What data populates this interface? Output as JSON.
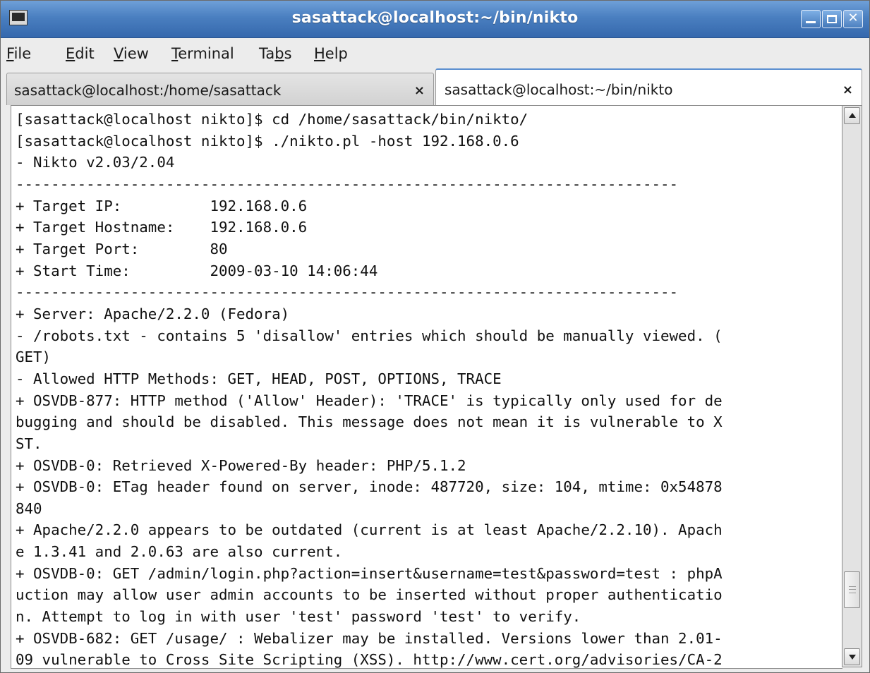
{
  "window": {
    "title": "sasattack@localhost:~/bin/nikto",
    "icon": "terminal-icon",
    "controls": {
      "minimize": "minimize",
      "maximize": "maximize",
      "close": "close"
    }
  },
  "menu": {
    "items": [
      {
        "label": "File",
        "mnemonic": "F",
        "rest": "ile"
      },
      {
        "label": "Edit",
        "mnemonic": "E",
        "rest": "dit"
      },
      {
        "label": "View",
        "mnemonic": "V",
        "rest": "iew"
      },
      {
        "label": "Terminal",
        "mnemonic": "T",
        "rest": "erminal"
      },
      {
        "label": "Tabs",
        "pre": "Ta",
        "mnemonic": "b",
        "rest": "s"
      },
      {
        "label": "Help",
        "mnemonic": "H",
        "rest": "elp"
      }
    ]
  },
  "tabs": [
    {
      "label": "sasattack@localhost:/home/sasattack",
      "close": "×",
      "active": false
    },
    {
      "label": "sasattack@localhost:~/bin/nikto",
      "close": "×",
      "active": true
    }
  ],
  "terminal": {
    "lines": [
      "[sasattack@localhost nikto]$ cd /home/sasattack/bin/nikto/",
      "[sasattack@localhost nikto]$ ./nikto.pl -host 192.168.0.6",
      "- Nikto v2.03/2.04",
      "---------------------------------------------------------------------------",
      "+ Target IP:          192.168.0.6",
      "+ Target Hostname:    192.168.0.6",
      "+ Target Port:        80",
      "+ Start Time:         2009-03-10 14:06:44",
      "---------------------------------------------------------------------------",
      "+ Server: Apache/2.2.0 (Fedora)",
      "- /robots.txt - contains 5 'disallow' entries which should be manually viewed. (",
      "GET)",
      "- Allowed HTTP Methods: GET, HEAD, POST, OPTIONS, TRACE",
      "+ OSVDB-877: HTTP method ('Allow' Header): 'TRACE' is typically only used for de",
      "bugging and should be disabled. This message does not mean it is vulnerable to X",
      "ST.",
      "+ OSVDB-0: Retrieved X-Powered-By header: PHP/5.1.2",
      "+ OSVDB-0: ETag header found on server, inode: 487720, size: 104, mtime: 0x54878",
      "840",
      "+ Apache/2.2.0 appears to be outdated (current is at least Apache/2.2.10). Apach",
      "e 1.3.41 and 2.0.63 are also current.",
      "+ OSVDB-0: GET /admin/login.php?action=insert&username=test&password=test : phpA",
      "uction may allow user admin accounts to be inserted without proper authenticatio",
      "n. Attempt to log in with user 'test' password 'test' to verify.",
      "+ OSVDB-682: GET /usage/ : Webalizer may be installed. Versions lower than 2.01-",
      "09 vulnerable to Cross Site Scripting (XSS). http://www.cert.org/advisories/CA-2"
    ]
  },
  "scrollbar": {
    "position": 0.92,
    "visible_fraction": 0.07
  },
  "colors": {
    "titlebar": "#4a7fc0",
    "accent": "#5b8fd0",
    "terminal_bg": "#ffffff",
    "terminal_fg": "#111111"
  }
}
